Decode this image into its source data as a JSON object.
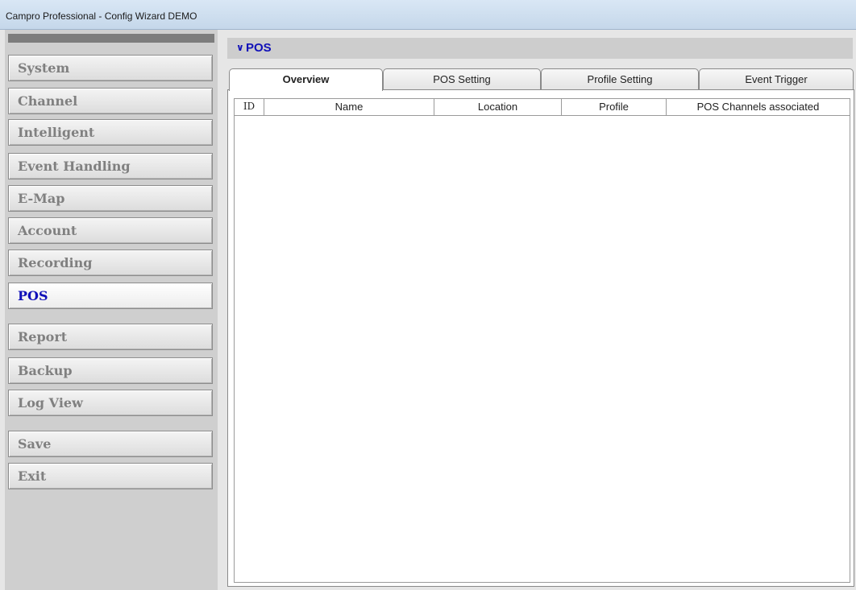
{
  "window": {
    "title": "Campro Professional - Config Wizard DEMO"
  },
  "sidebar": {
    "items": [
      {
        "label": "System",
        "active": false
      },
      {
        "label": "Channel",
        "active": false
      },
      {
        "label": "Intelligent",
        "active": false
      },
      {
        "label": "Event Handling",
        "active": false
      },
      {
        "label": "E-Map",
        "active": false
      },
      {
        "label": "Account",
        "active": false
      },
      {
        "label": "Recording",
        "active": false
      },
      {
        "label": "POS",
        "active": true
      },
      {
        "label": "Report",
        "active": false
      },
      {
        "label": "Backup",
        "active": false
      },
      {
        "label": "Log View",
        "active": false
      }
    ],
    "save_label": "Save",
    "exit_label": "Exit"
  },
  "main": {
    "header_title": "POS",
    "header_icon": "pos-chevrons-icon",
    "tabs": [
      {
        "label": "Overview",
        "active": true
      },
      {
        "label": "POS Setting",
        "active": false
      },
      {
        "label": "Profile Setting",
        "active": false
      },
      {
        "label": "Event Trigger",
        "active": false
      }
    ],
    "table": {
      "columns": [
        "ID",
        "Name",
        "Location",
        "Profile",
        "POS Channels associated"
      ],
      "rows": []
    }
  },
  "colors": {
    "active_text": "#1010b8",
    "inactive_text": "#808080",
    "panel_bg": "#cfcfcf"
  }
}
